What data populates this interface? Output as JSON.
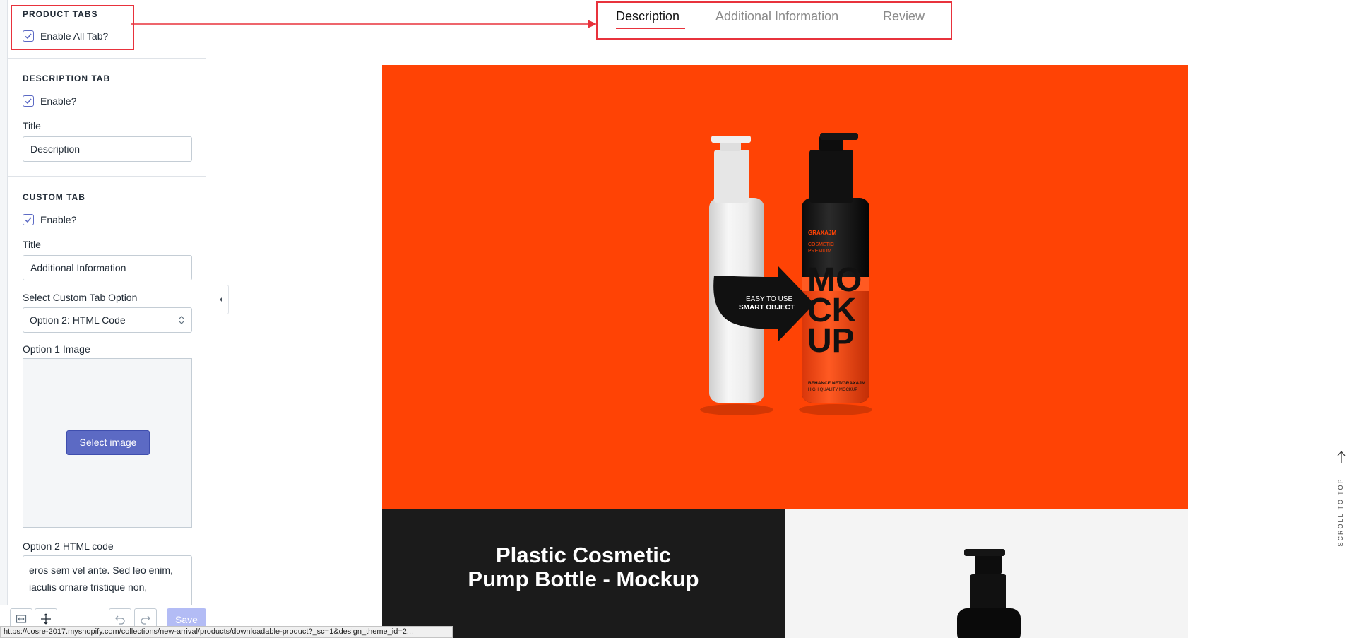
{
  "sidebar": {
    "product_tabs": {
      "heading": "PRODUCT TABS",
      "enable_all_label": "Enable All Tab?",
      "enable_all_checked": true
    },
    "description_tab": {
      "heading": "DESCRIPTION TAB",
      "enable_label": "Enable?",
      "enable_checked": true,
      "title_label": "Title",
      "title_value": "Description"
    },
    "custom_tab": {
      "heading": "CUSTOM TAB",
      "enable_label": "Enable?",
      "enable_checked": true,
      "title_label": "Title",
      "title_value": "Additional Information",
      "select_label": "Select Custom Tab Option",
      "select_value": "Option 2: HTML Code",
      "option1_label": "Option 1 Image",
      "select_image_button": "Select image",
      "option2_label": "Option 2 HTML code",
      "option2_value": "eros sem vel ante. Sed leo enim, iaculis ornare tristique non,"
    },
    "footer": {
      "save_label": "Save"
    }
  },
  "status_bar": {
    "url": "https://cosre-2017.myshopify.com/collections/new-arrival/products/downloadable-product?_sc=1&design_theme_id=2..."
  },
  "preview": {
    "tabs": [
      {
        "label": "Description",
        "active": true
      },
      {
        "label": "Additional Information",
        "active": false
      },
      {
        "label": "Review",
        "active": false
      }
    ],
    "hero": {
      "bottle_brand": "GRAXAJM",
      "bottle_line1": "COSMETIC",
      "bottle_line2": "PREMIUM",
      "bottle_big": [
        "MO",
        "CK",
        "UP"
      ],
      "bottle_url": "BEHANCE.NET/GRAXAJM",
      "bottle_tag": "HIGH QUALITY MOCKUP",
      "arrow_line1": "EASY TO USE",
      "arrow_line2": "SMART OBJECT"
    },
    "product_title_line1": "Plastic Cosmetic",
    "product_title_line2": "Pump Bottle - Mockup",
    "scroll_to_top": "SCROLL TO TOP"
  },
  "colors": {
    "accent": "#5c6ac4",
    "hero_orange": "#ff4305",
    "annotation_red": "#e8323c",
    "dark_panel": "#1b1b1b"
  },
  "icons": [
    "checkbox-check-icon",
    "select-arrows-icon",
    "collapse-left-icon",
    "code-editor-icon",
    "move-icon",
    "undo-icon",
    "redo-icon",
    "arrow-up-icon"
  ]
}
